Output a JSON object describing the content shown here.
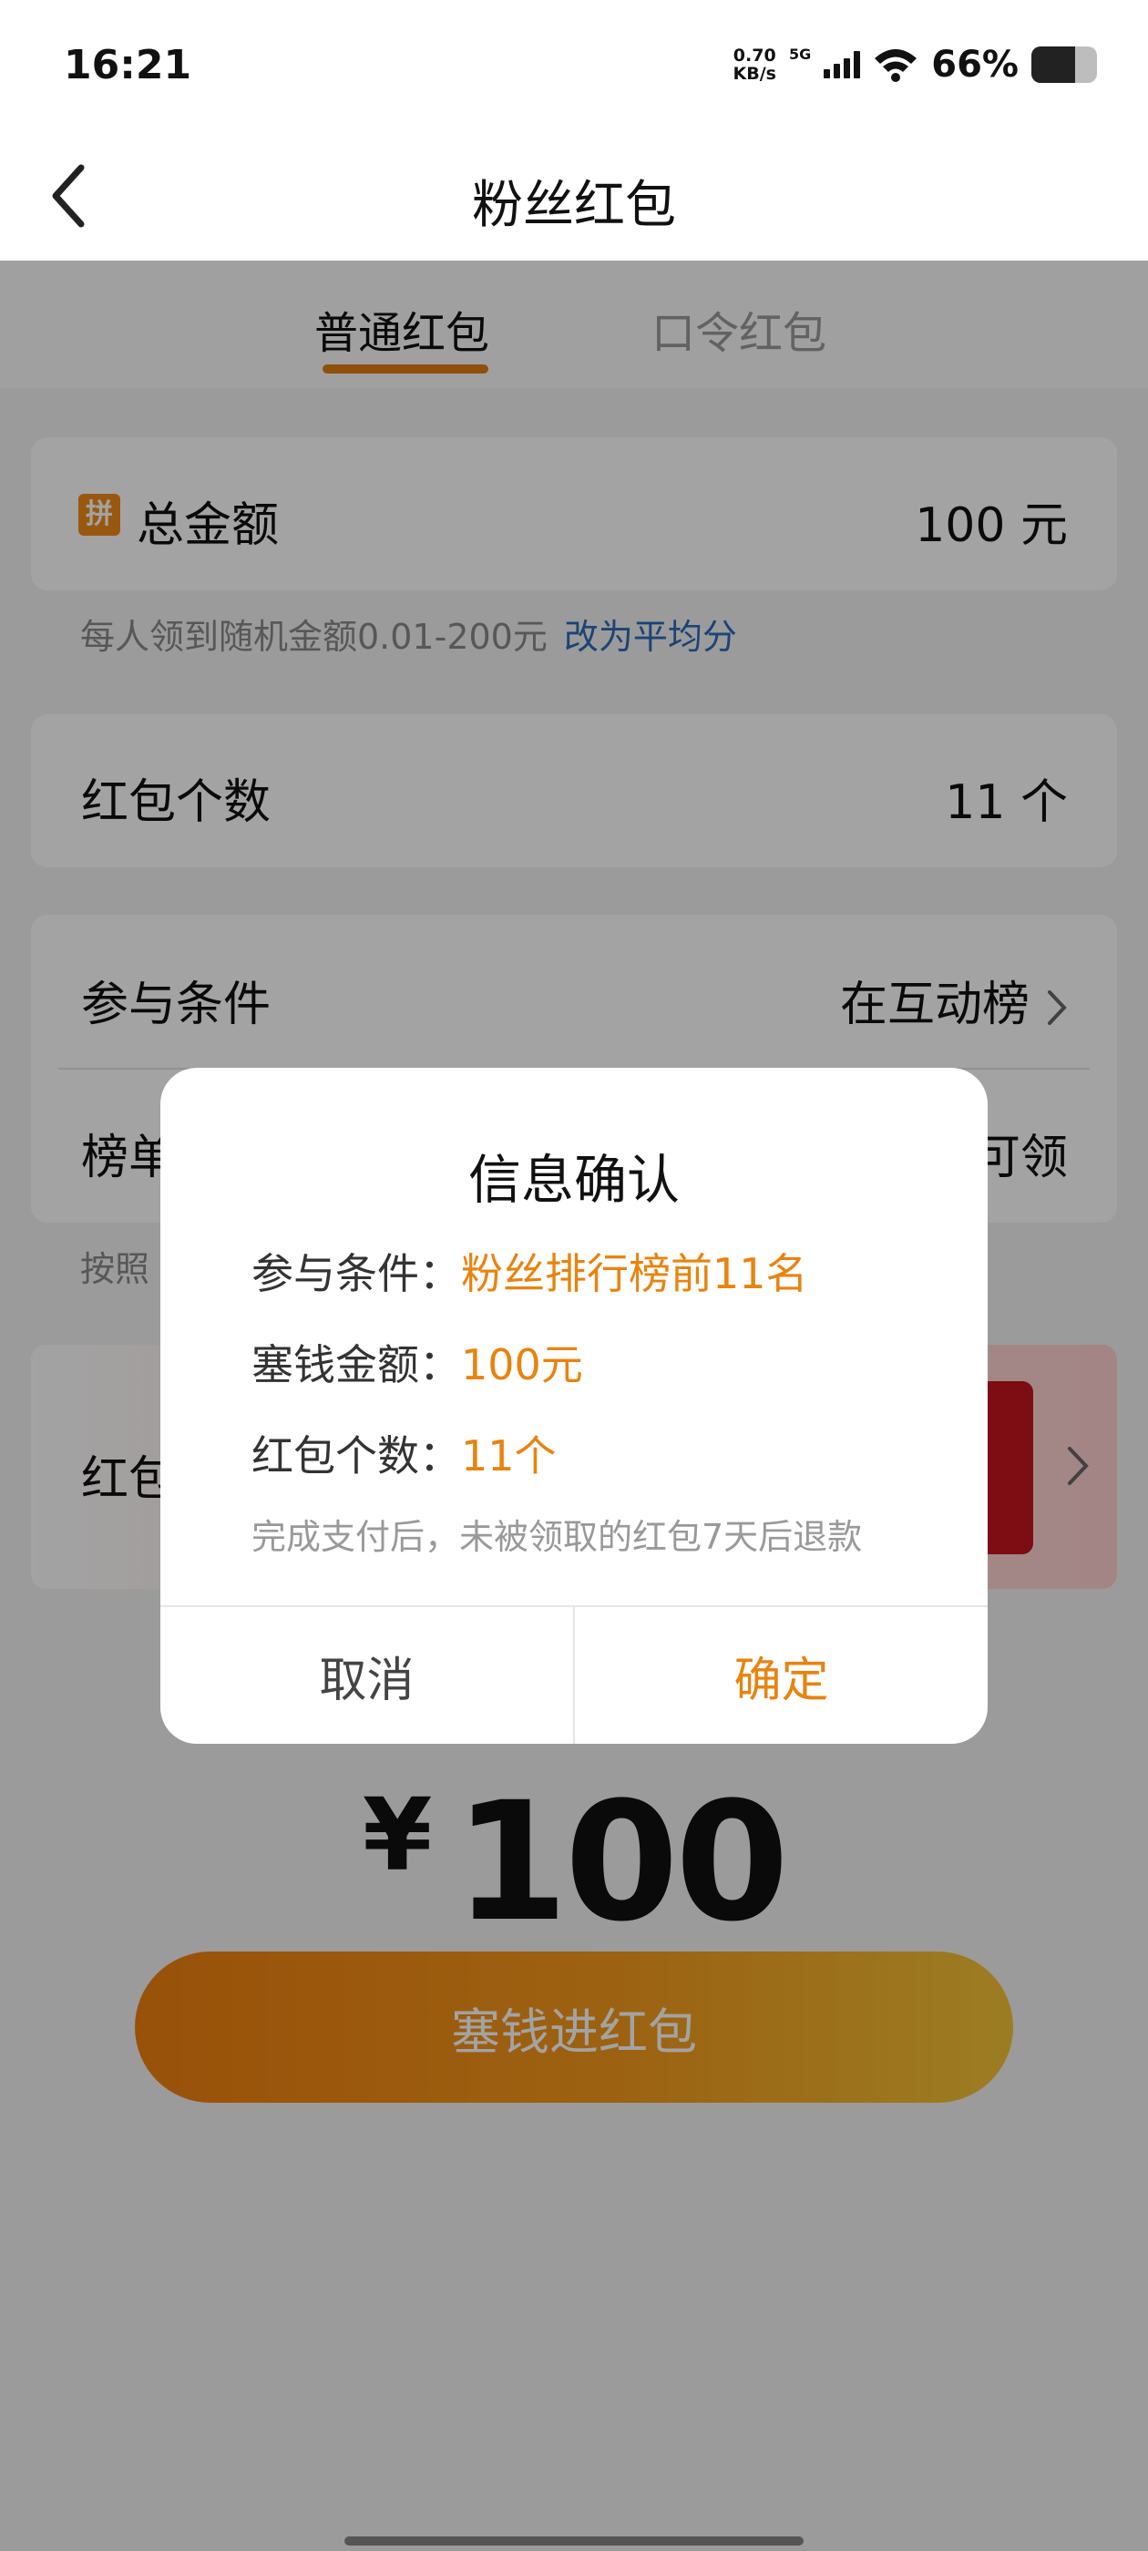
{
  "status_bar": {
    "time": "16:21",
    "speed_value": "0.70",
    "speed_unit": "KB/s",
    "network": "5G",
    "battery_percent": "66%",
    "battery_level": 0.66
  },
  "nav": {
    "title": "粉丝红包"
  },
  "tabs": [
    {
      "label": "普通红包",
      "active": true
    },
    {
      "label": "口令红包",
      "active": false
    }
  ],
  "form": {
    "total_amount": {
      "icon_text": "拼",
      "label": "总金额",
      "value": "100 元"
    },
    "amount_hint": {
      "text": "每人领到随机金额0.01-200元",
      "link": "改为平均分"
    },
    "count": {
      "label": "红包个数",
      "value": "11 个"
    },
    "condition": {
      "label": "参与条件",
      "value": "在互动榜"
    },
    "ranking": {
      "label": "榜单",
      "value": "可领"
    },
    "ranking_hint": "按照",
    "cover": {
      "label": "红包"
    }
  },
  "total": {
    "currency": "¥",
    "amount": "100"
  },
  "pay_button": "塞钱进红包",
  "dialog": {
    "title": "信息确认",
    "rows": [
      {
        "label": "参与条件：",
        "value": "粉丝排行榜前11名"
      },
      {
        "label": "塞钱金额：",
        "value": "100元"
      },
      {
        "label": "红包个数：",
        "value": "11个"
      }
    ],
    "note": "完成支付后，未被领取的红包7天后退款",
    "cancel": "取消",
    "confirm": "确定"
  },
  "colors": {
    "accent": "#e8830f",
    "link": "#2d6bb7",
    "red": "#c4151e"
  }
}
